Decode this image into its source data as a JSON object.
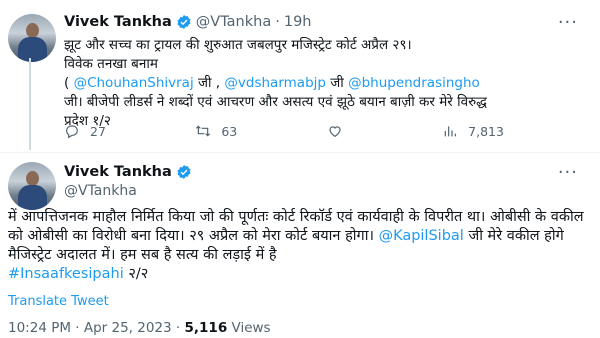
{
  "tweet1": {
    "author_name": "Vivek Tankha",
    "handle": "@VTankha",
    "separator": "·",
    "time": "19h",
    "line1": "झूट और सच्च का ट्रायल की शुरुआत जबलपुर मजिस्ट्रेट कोर्ट अप्रैल २९।",
    "line2": "विवेक तनखा बनाम",
    "line3_open": "(",
    "mention1": "@ChouhanShivraj",
    "joiner1": "जी ,",
    "mention2": "@vdsharmabjp",
    "joiner2": "जी",
    "mention3": "@bhupendrasingho",
    "line4": "जी। बीजेपी लीडर्स ने शब्दों एवं आचरण और असत्य एवं झूठे बयान बाज़ी कर मेरे विरुद्ध",
    "line5": "प्रदेश १/२",
    "replies": "27",
    "retweets": "63",
    "likes": "",
    "views": "7,813"
  },
  "tweet2": {
    "author_name": "Vivek Tankha",
    "handle": "@VTankha",
    "para1": "में आपत्तिजनक माहौल निर्मित किया जो की पूर्णतः कोर्ट रिकॉर्ड एवं कार्यवाही के विपरीत था। ओबीसी के वकील को ओबीसी का विरोधी बना दिया। २९ अप्रैल को मेरा कोर्ट बयान होगा।",
    "mention": "@KapilSibal",
    "para2": "जी मेरे वकील होगे मैजिस्ट्रेट अदालत में। हम सब है सत्य की लड़ाई में है",
    "hashtag": "#Insaafkesipahi",
    "suffix": "२/२",
    "translate": "Translate Tweet",
    "timestamp": "10:24 PM · Apr 25, 2023 ·",
    "views_count": "5,116",
    "views_label": "Views"
  },
  "colors": {
    "accent": "#1d9bf0",
    "muted": "#536471",
    "text": "#0f1419"
  },
  "icons": [
    "verified-badge-icon",
    "more-icon",
    "reply-icon",
    "retweet-icon",
    "like-icon",
    "views-icon"
  ]
}
